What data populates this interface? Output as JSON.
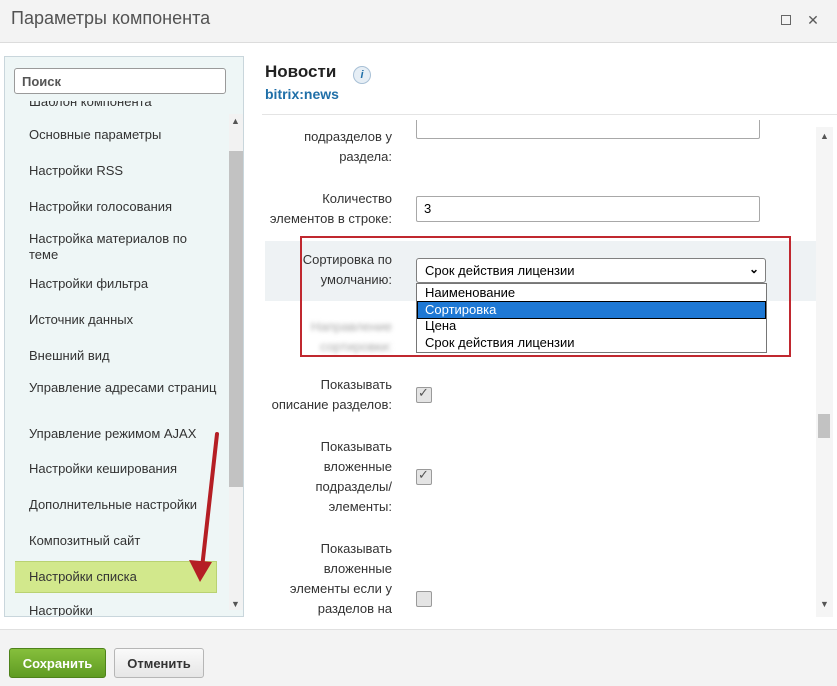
{
  "window": {
    "title": "Параметры компонента"
  },
  "sidebar": {
    "search_placeholder": "Поиск",
    "items": [
      {
        "label": "Шаблон компонента"
      },
      {
        "label": "Основные параметры"
      },
      {
        "label": "Настройки RSS"
      },
      {
        "label": "Настройки голосования"
      },
      {
        "label": "Настройка материалов по теме"
      },
      {
        "label": "Настройки фильтра"
      },
      {
        "label": "Источник данных"
      },
      {
        "label": "Внешний вид"
      },
      {
        "label": "Управление адресами страниц"
      },
      {
        "label": "Управление режимом AJAX"
      },
      {
        "label": "Настройки кеширования"
      },
      {
        "label": "Дополнительные настройки"
      },
      {
        "label": "Композитный сайт"
      },
      {
        "label": "Настройки списка"
      },
      {
        "label": "Настройки"
      }
    ],
    "active_item": "Настройки списка"
  },
  "component": {
    "title": "Новости",
    "code": "bitrix:news"
  },
  "params": {
    "sections_in_row_label": "подразделов у раздела:",
    "elements_in_row_label": "Количество элементов в строке:",
    "elements_in_row_value": "3",
    "default_sort_label": "Сортировка по умолчанию:",
    "default_sort_value": "Срок действия лицензии",
    "sort_options": [
      "Наименование",
      "Сортировка",
      "Цена",
      "Срок действия лицензии"
    ],
    "sort_highlighted": "Сортировка",
    "sort_direction_label": "Направление сортировки:",
    "show_section_desc_label": "Показывать описание разделов:",
    "show_section_desc": true,
    "show_nested_label": "Показывать вложенные подразделы/ элементы:",
    "show_nested": true,
    "show_elements_if_label": "Показывать вложенные элементы если у разделов на",
    "show_elements_if": false
  },
  "footer": {
    "save_label": "Сохранить",
    "cancel_label": "Отменить"
  },
  "colors": {
    "accent": "#1f6fa8",
    "active_item": "#d2e88c",
    "save_button": "#6aa12e",
    "annotation": "#c0282f"
  }
}
